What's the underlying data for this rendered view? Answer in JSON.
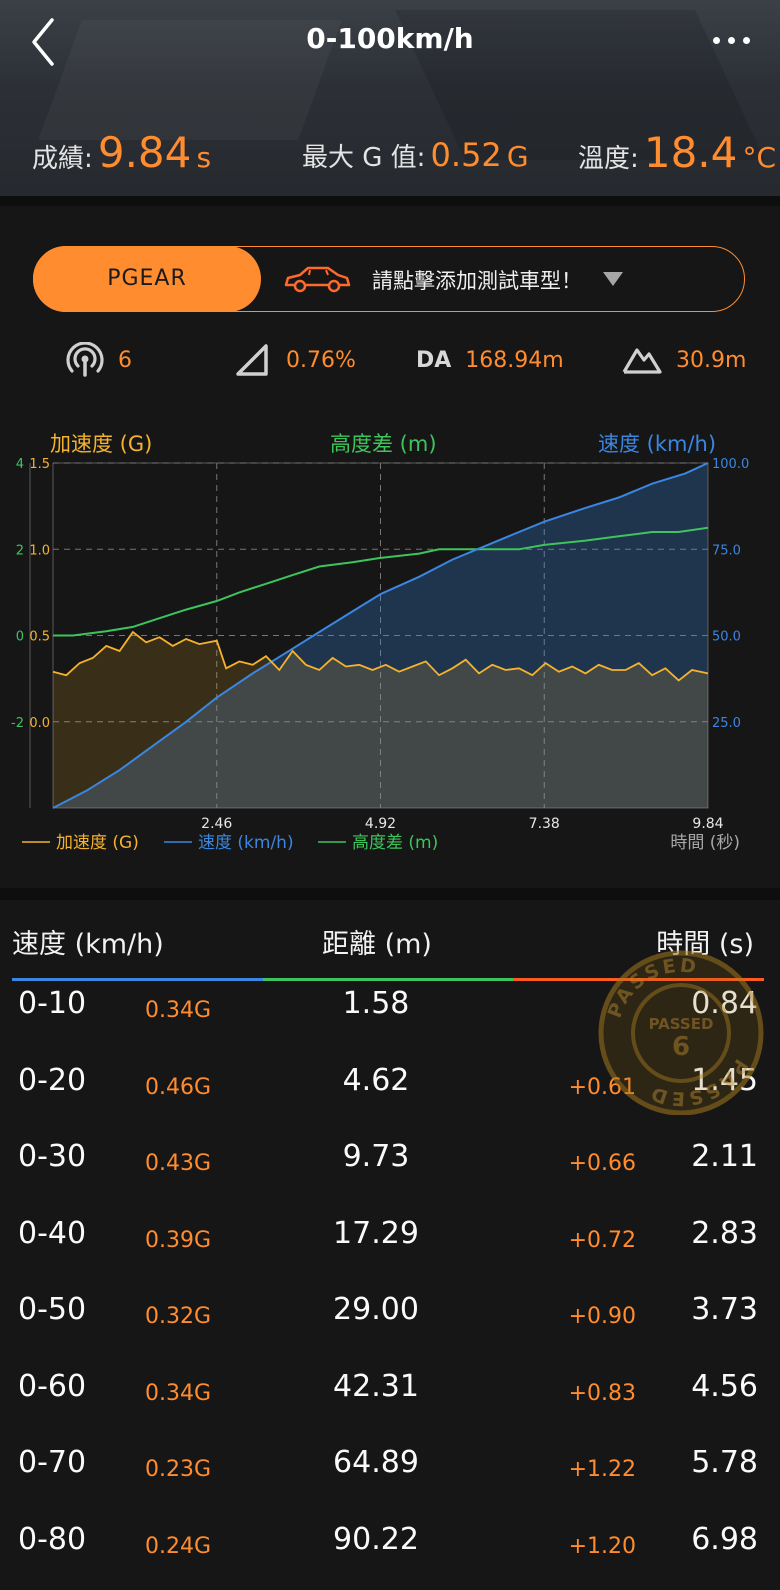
{
  "header": {
    "title": "0-100km/h",
    "result_label": "成績:",
    "result_value": "9.84",
    "result_unit": "s",
    "max_g_label": "最大 G 值:",
    "max_g_value": "0.52",
    "max_g_unit": "G",
    "temp_label": "溫度:",
    "temp_value": "18.4",
    "temp_unit": "°C"
  },
  "selector": {
    "tab_label": "PGEAR",
    "add_car_text": "請點擊添加測試車型！",
    "car_icon": "car-icon",
    "dropdown_icon": "triangle-down-icon"
  },
  "info_row": {
    "satellites": "6",
    "slope": "0.76%",
    "da_label": "DA",
    "da_value": "168.94m",
    "altitude": "30.9m"
  },
  "colors": {
    "accent": "#ff8c2e",
    "accel": "#f5b22d",
    "speed": "#3a86e0",
    "altitude": "#3ec45c",
    "bg": "#161616"
  },
  "chart_data": {
    "type": "line",
    "axis_titles": {
      "accel": "加速度 (G)",
      "altitude": "高度差 (m)",
      "speed": "速度 (km/h)"
    },
    "x_ticks": [
      "2.46",
      "4.92",
      "7.38",
      "9.84"
    ],
    "x_axis_label": "時間 (秒)",
    "xlim": [
      0,
      9.84
    ],
    "y_left_accel_ticks": [
      "1.5",
      "1.0",
      "0.5",
      "0.0"
    ],
    "ylim_accel": [
      -0.5,
      1.5
    ],
    "y_left_altitude_ticks": [
      "4",
      "2",
      "0",
      "-2"
    ],
    "ylim_altitude": [
      -4,
      4
    ],
    "y_right_speed_ticks": [
      "100.0",
      "75.0",
      "50.0",
      "25.0"
    ],
    "ylim_speed": [
      0,
      100
    ],
    "grid": true,
    "legend": [
      "加速度 (G)",
      "速度 (km/h)",
      "高度差 (m)"
    ],
    "series": [
      {
        "name": "速度 (km/h)",
        "x": [
          0,
          0.5,
          1.0,
          1.5,
          2.0,
          2.46,
          3.0,
          3.5,
          4.0,
          4.5,
          4.92,
          5.5,
          6.0,
          6.5,
          7.0,
          7.38,
          8.0,
          8.5,
          9.0,
          9.5,
          9.84
        ],
        "values": [
          0,
          5,
          11,
          18,
          25,
          32,
          39,
          45,
          51,
          57,
          62,
          67,
          72,
          76,
          80,
          83,
          87,
          90,
          94,
          97,
          100
        ]
      },
      {
        "name": "加速度 (G)",
        "x": [
          0,
          0.2,
          0.4,
          0.6,
          0.8,
          1.0,
          1.2,
          1.4,
          1.6,
          1.8,
          2.0,
          2.2,
          2.46,
          2.6,
          2.8,
          3.0,
          3.2,
          3.4,
          3.6,
          3.8,
          4.0,
          4.2,
          4.4,
          4.6,
          4.8,
          5.0,
          5.2,
          5.4,
          5.6,
          5.8,
          6.0,
          6.2,
          6.4,
          6.6,
          6.8,
          7.0,
          7.2,
          7.4,
          7.6,
          7.8,
          8.0,
          8.2,
          8.4,
          8.6,
          8.8,
          9.0,
          9.2,
          9.4,
          9.6,
          9.84
        ],
        "values": [
          0.29,
          0.27,
          0.34,
          0.37,
          0.44,
          0.41,
          0.52,
          0.46,
          0.49,
          0.44,
          0.48,
          0.45,
          0.47,
          0.31,
          0.35,
          0.33,
          0.38,
          0.3,
          0.41,
          0.33,
          0.3,
          0.37,
          0.32,
          0.33,
          0.3,
          0.33,
          0.29,
          0.32,
          0.35,
          0.27,
          0.31,
          0.36,
          0.28,
          0.33,
          0.3,
          0.31,
          0.27,
          0.34,
          0.29,
          0.32,
          0.28,
          0.33,
          0.3,
          0.3,
          0.34,
          0.27,
          0.31,
          0.24,
          0.3,
          0.28
        ]
      },
      {
        "name": "高度差 (m)",
        "x": [
          0,
          0.3,
          0.8,
          1.2,
          1.6,
          2.0,
          2.46,
          2.8,
          3.2,
          3.6,
          4.0,
          4.5,
          4.92,
          5.5,
          5.8,
          6.5,
          7.0,
          7.38,
          8.0,
          8.5,
          9.0,
          9.4,
          9.84
        ],
        "values": [
          0,
          0,
          0.1,
          0.2,
          0.4,
          0.6,
          0.8,
          1.0,
          1.2,
          1.4,
          1.6,
          1.7,
          1.8,
          1.9,
          2.0,
          2.0,
          2.0,
          2.1,
          2.2,
          2.3,
          2.4,
          2.4,
          2.5
        ]
      }
    ]
  },
  "table": {
    "headers": {
      "speed": "速度 (km/h)",
      "distance": "距離 (m)",
      "time": "時間 (s)"
    },
    "rows": [
      {
        "range": "0-10",
        "g": "0.34G",
        "distance": "1.58",
        "delta": "",
        "time": "0.84"
      },
      {
        "range": "0-20",
        "g": "0.46G",
        "distance": "4.62",
        "delta": "+0.61",
        "time": "1.45"
      },
      {
        "range": "0-30",
        "g": "0.43G",
        "distance": "9.73",
        "delta": "+0.66",
        "time": "2.11"
      },
      {
        "range": "0-40",
        "g": "0.39G",
        "distance": "17.29",
        "delta": "+0.72",
        "time": "2.83"
      },
      {
        "range": "0-50",
        "g": "0.32G",
        "distance": "29.00",
        "delta": "+0.90",
        "time": "3.73"
      },
      {
        "range": "0-60",
        "g": "0.34G",
        "distance": "42.31",
        "delta": "+0.83",
        "time": "4.56"
      },
      {
        "range": "0-70",
        "g": "0.23G",
        "distance": "64.89",
        "delta": "+1.22",
        "time": "5.78"
      },
      {
        "range": "0-80",
        "g": "0.24G",
        "distance": "90.22",
        "delta": "+1.20",
        "time": "6.98"
      }
    ]
  },
  "stamp": {
    "text": "PASSED",
    "number": "6"
  }
}
